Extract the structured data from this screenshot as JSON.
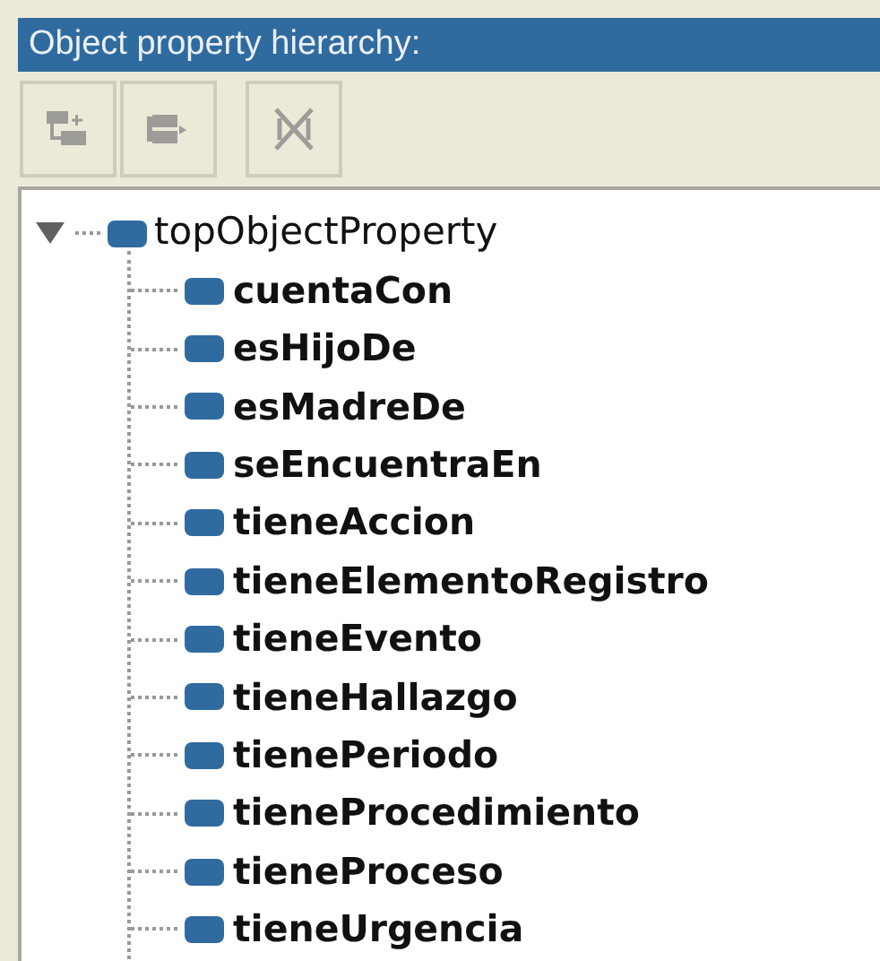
{
  "panel": {
    "title": "Object property hierarchy:"
  },
  "toolbar": [
    {
      "kind": "add-sub",
      "disabled": true
    },
    {
      "kind": "add-sibling",
      "disabled": true
    },
    {
      "kind": "delete",
      "disabled": true
    }
  ],
  "tree": [
    {
      "label": "topObjectProperty",
      "expanded": true,
      "children": [
        {
          "label": "cuentaCon"
        },
        {
          "label": "esHijoDe"
        },
        {
          "label": "esMadreDe"
        },
        {
          "label": "seEncuentraEn"
        },
        {
          "label": "tieneAccion"
        },
        {
          "label": "tieneElementoRegistro"
        },
        {
          "label": "tieneEvento"
        },
        {
          "label": "tieneHallazgo"
        },
        {
          "label": "tienePeriodo"
        },
        {
          "label": "tieneProcedimiento"
        },
        {
          "label": "tieneProceso"
        },
        {
          "label": "tieneUrgencia"
        }
      ]
    }
  ]
}
